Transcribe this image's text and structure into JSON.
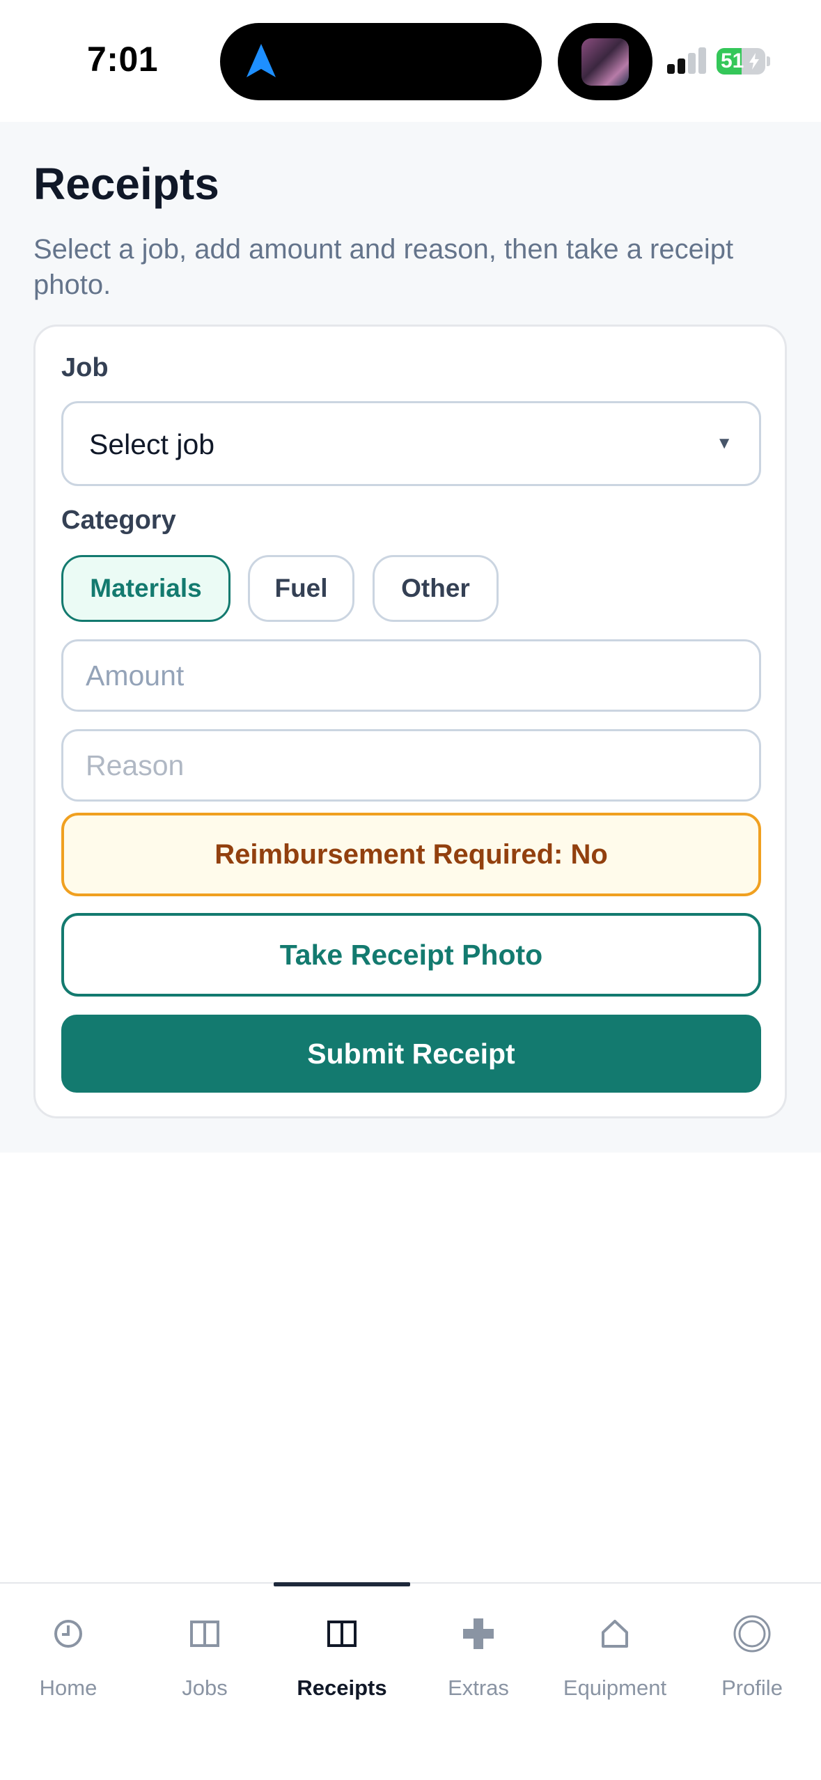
{
  "status_bar": {
    "time": "7:01",
    "battery_percent": "51",
    "battery_level": 0.51
  },
  "page": {
    "title": "Receipts",
    "subtitle": "Select a job, add amount and reason, then take a receipt photo."
  },
  "form": {
    "job_label": "Job",
    "job_select_value": "Select job",
    "category_label": "Category",
    "categories": [
      "Materials",
      "Fuel",
      "Other"
    ],
    "selected_category": "Materials",
    "amount_placeholder": "Amount",
    "reason_placeholder": "Reason",
    "reimbursement_text": "Reimbursement Required: No",
    "take_photo_label": "Take Receipt Photo",
    "submit_label": "Submit Receipt"
  },
  "colors": {
    "accent": "#137a6f",
    "warning_border": "#f0a020",
    "warning_text": "#92400e"
  },
  "tabbar": {
    "active": "Receipts",
    "tabs": [
      {
        "label": "Home",
        "icon": "clock-icon"
      },
      {
        "label": "Jobs",
        "icon": "book-icon"
      },
      {
        "label": "Receipts",
        "icon": "book-icon"
      },
      {
        "label": "Extras",
        "icon": "plus-icon"
      },
      {
        "label": "Equipment",
        "icon": "house-icon"
      },
      {
        "label": "Profile",
        "icon": "profile-circle-icon"
      }
    ]
  }
}
